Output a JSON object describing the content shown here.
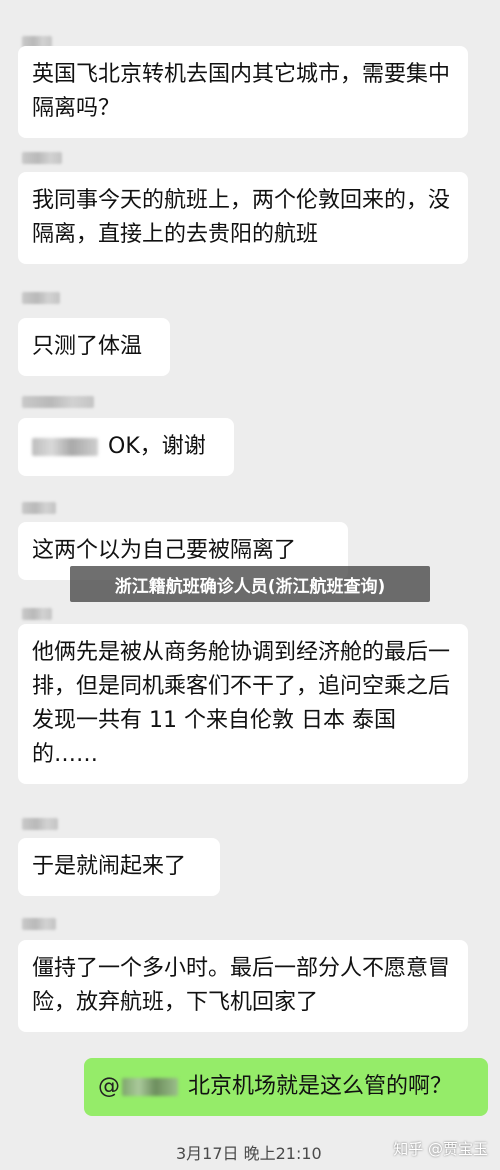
{
  "messages": [
    {
      "text": "英国飞北京转机去国内其它城市，需要集中隔离吗？"
    },
    {
      "text": "我同事今天的航班上，两个伦敦回来的，没隔离，直接上的去贵阳的航班"
    },
    {
      "text": "只测了体温"
    },
    {
      "mention": "",
      "text": "OK，谢谢"
    },
    {
      "text": "这两个以为自己要被隔离了"
    },
    {
      "text": "他俩先是被从商务舱协调到经济舱的最后一排，但是同机乘客们不干了，追问空乘之后发现一共有 11 个来自伦敦 日本 泰国的……"
    },
    {
      "text": "于是就闹起来了"
    },
    {
      "text": "僵持了一个多小时。最后一部分人不愿意冒险，放弃航班，下飞机回家了"
    },
    {
      "mention_prefix": "@",
      "text": "北京机场就是这么管的啊？"
    }
  ],
  "overlay_title": "浙江籍航班确诊人员(浙江航班查询)",
  "timestamp": "3月17日 晚上21:10",
  "watermark": "知乎 @贾宝玉",
  "colors": {
    "background": "#ededed",
    "incoming_bubble": "#ffffff",
    "outgoing_bubble": "#95ec69",
    "overlay": "#464646"
  }
}
